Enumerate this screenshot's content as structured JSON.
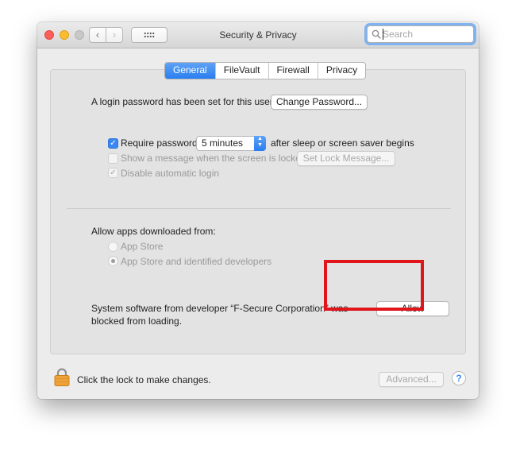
{
  "window": {
    "title": "Security & Privacy",
    "search": {
      "placeholder": "Search",
      "value": ""
    }
  },
  "nav": {
    "back_glyph": "‹",
    "forward_glyph": "›"
  },
  "tabs": [
    {
      "label": "General",
      "active": true
    },
    {
      "label": "FileVault",
      "active": false
    },
    {
      "label": "Firewall",
      "active": false
    },
    {
      "label": "Privacy",
      "active": false
    }
  ],
  "general": {
    "login_password_text": "A login password has been set for this user",
    "change_password_label": "Change Password...",
    "require_password": {
      "label": "Require password",
      "checked": true
    },
    "require_password_delay": "5 minutes",
    "require_password_suffix": "after sleep or screen saver begins",
    "show_message": {
      "label": "Show a message when the screen is locked",
      "checked": false,
      "enabled": false
    },
    "set_lock_message_label": "Set Lock Message...",
    "disable_auto_login": {
      "label": "Disable automatic login",
      "checked": true,
      "enabled": false
    },
    "allow_apps_heading": "Allow apps downloaded from:",
    "radio_options": [
      {
        "label": "App Store",
        "selected": false
      },
      {
        "label": "App Store and identified developers",
        "selected": true
      }
    ],
    "blocked_message_line1": "System software from developer “F-Secure Corporation” was",
    "blocked_message_line2": "blocked from loading.",
    "allow_button_label": "Allow"
  },
  "footer": {
    "lock_text": "Click the lock to make changes.",
    "advanced_label": "Advanced...",
    "help_glyph": "?"
  },
  "colors": {
    "accent": "#2a7ef0",
    "highlight_box": "#e0161c",
    "lock": "#f0a23a"
  },
  "icons": [
    "search-icon",
    "grid-icon",
    "lock-icon",
    "help-icon"
  ]
}
